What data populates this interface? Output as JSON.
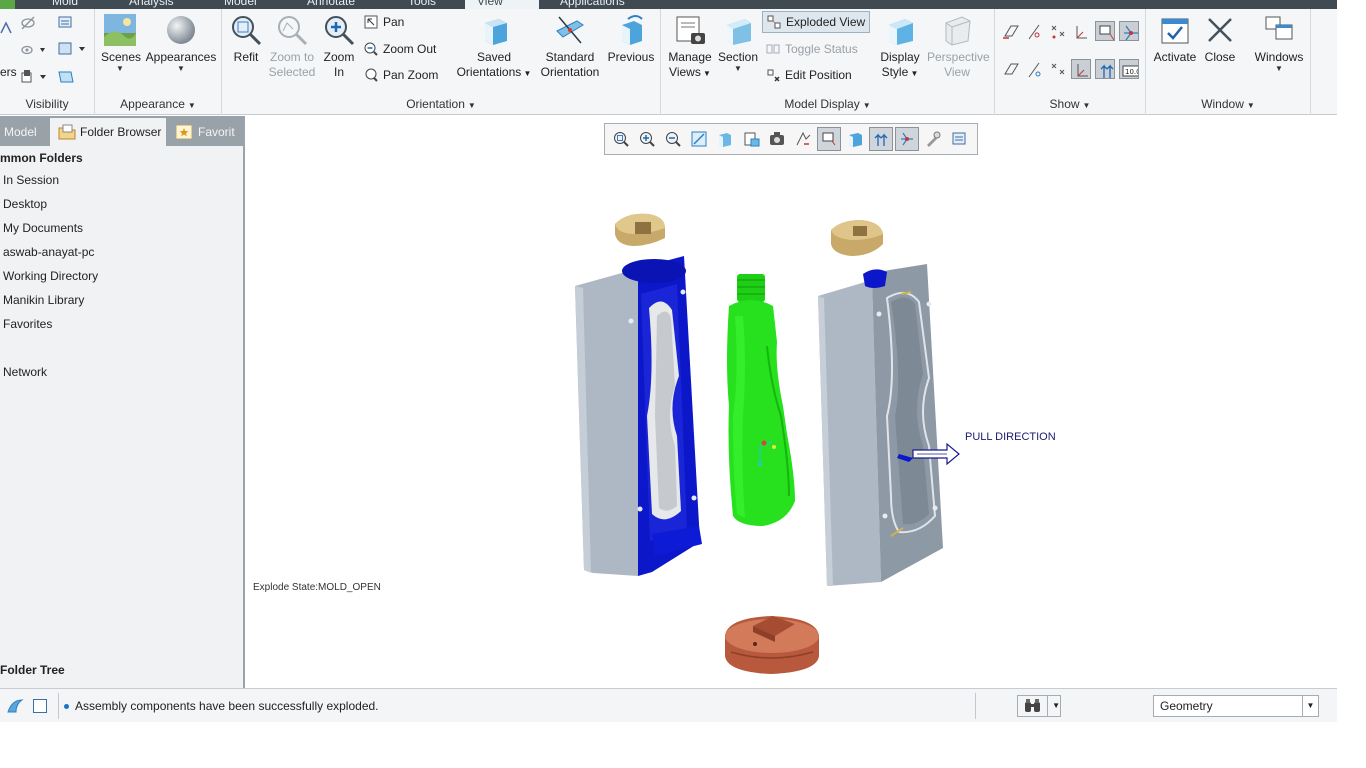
{
  "tabs": {
    "items": [
      "Mold",
      "Analysis",
      "Model",
      "Annotate",
      "Tools",
      "View",
      "Applications"
    ],
    "active": "View"
  },
  "ribbon": {
    "visibility": {
      "label": "Visibility",
      "left_text": "ers"
    },
    "appearance": {
      "label": "Appearance",
      "scenes": "Scenes",
      "appearances": "Appearances"
    },
    "orientation": {
      "label": "Orientation",
      "refit": "Refit",
      "zoom_to_selected": "Zoom to Selected",
      "zoom_in": "Zoom In",
      "pan": "Pan",
      "zoom_out": "Zoom Out",
      "pan_zoom": "Pan Zoom",
      "saved_orientations": "Saved Orientations",
      "standard_orientation": "Standard Orientation",
      "previous": "Previous"
    },
    "model_display": {
      "label": "Model Display",
      "manage_views": "Manage Views",
      "section": "Section",
      "exploded_view": "Exploded View",
      "toggle_status": "Toggle Status",
      "edit_position": "Edit Position",
      "display_style": "Display Style",
      "perspective_view": "Perspective View"
    },
    "show": {
      "label": "Show"
    },
    "window": {
      "label": "Window",
      "activate": "Activate",
      "close": "Close",
      "windows": "Windows"
    }
  },
  "navigator": {
    "tabs": [
      "Model",
      "Folder Browser",
      "Favorit"
    ],
    "active_tab": "Folder Browser",
    "heading": "mmon Folders",
    "items": [
      "In Session",
      "Desktop",
      "My Documents",
      "aswab-anayat-pc",
      "Working Directory",
      "Manikin Library",
      "Favorites",
      "Network"
    ],
    "footer": "Folder Tree"
  },
  "graphics": {
    "explode_state": "Explode State:MOLD_OPEN",
    "pull_direction": "PULL DIRECTION"
  },
  "statusbar": {
    "message": "Assembly components have been successfully exploded.",
    "filter_value": "Geometry"
  },
  "colors": {
    "mold_plate": "#a9b3c0",
    "cavity_blue": "#0b17c9",
    "bottle_green": "#27e01e",
    "insert_tan": "#c8a96a",
    "base_copper": "#b8593d"
  }
}
